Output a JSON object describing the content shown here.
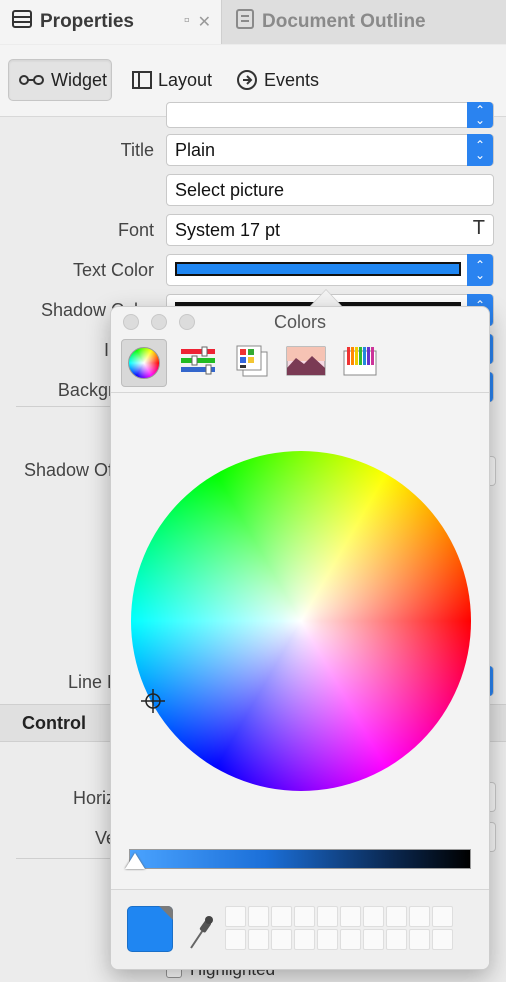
{
  "tabs": {
    "properties": "Properties",
    "document_outline": "Document Outline"
  },
  "toolbar": {
    "widget": "Widget",
    "layout": "Layout",
    "events": "Events"
  },
  "properties": {
    "title_label": "Title",
    "title_value": "Plain",
    "picture_value": "Select picture",
    "font_label": "Font",
    "font_value": "System 17 pt",
    "text_color_label": "Text Color",
    "text_color_value": "#1f86f2",
    "shadow_color_label": "Shadow Color",
    "image_label": "Image",
    "background_label": "Background",
    "shadow_offset_label": "Shadow Offset",
    "line_break_label": "Line Break",
    "control_section": "Control",
    "horizontal_label": "Horizontal",
    "vertical_label": "Vertical",
    "highlighted_label": "Highlighted"
  },
  "colors_panel": {
    "title": "Colors",
    "modes": [
      "color-wheel",
      "color-sliders",
      "color-palettes",
      "image-palettes",
      "pencils"
    ],
    "selected_mode": "color-wheel",
    "current_color": "#1f86f2"
  }
}
